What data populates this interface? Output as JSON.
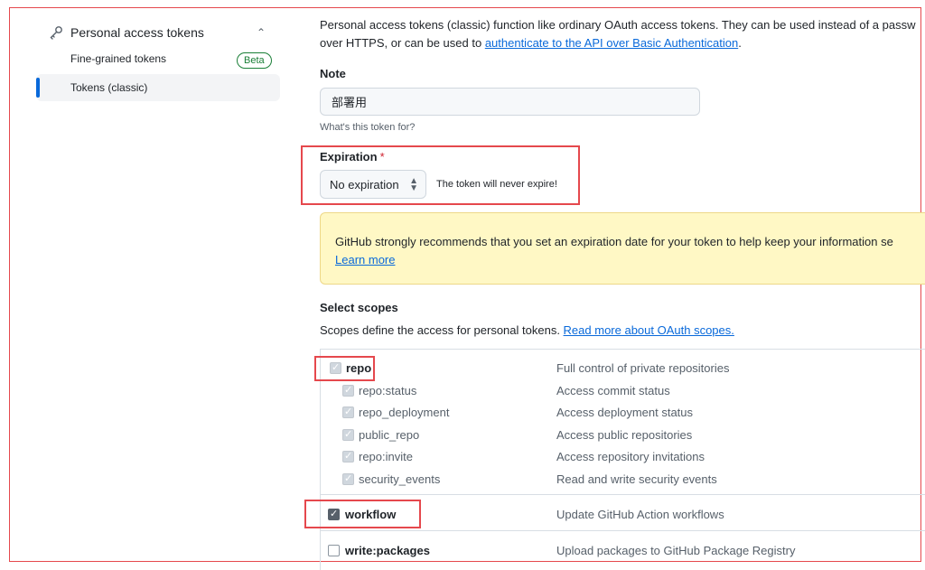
{
  "sidebar": {
    "section_label": "Personal access tokens",
    "items": [
      {
        "label": "Fine-grained tokens",
        "badge": "Beta"
      },
      {
        "label": "Tokens (classic)",
        "active": true
      }
    ]
  },
  "intro": {
    "line1": "Personal access tokens (classic) function like ordinary OAuth access tokens. They can be used instead of a passw",
    "line2_prefix": "over HTTPS, or can be used to ",
    "line2_link": "authenticate to the API over Basic Authentication",
    "line2_suffix": "."
  },
  "note": {
    "label": "Note",
    "value": "部署用",
    "hint": "What's this token for?"
  },
  "expiration": {
    "label": "Expiration",
    "required_mark": "*",
    "selected": "No expiration",
    "note": "The token will never expire!"
  },
  "warning": {
    "text": "GitHub strongly recommends that you set an expiration date for your token to help keep your information se",
    "link": "Learn more"
  },
  "scopes": {
    "title": "Select scopes",
    "desc_prefix": "Scopes define the access for personal tokens. ",
    "desc_link": "Read more about OAuth scopes.",
    "rows": [
      {
        "name": "repo",
        "desc": "Full control of private repositories",
        "state": "disabled-checked"
      },
      {
        "name": "repo:status",
        "desc": "Access commit status",
        "state": "disabled-checked"
      },
      {
        "name": "repo_deployment",
        "desc": "Access deployment status",
        "state": "disabled-checked"
      },
      {
        "name": "public_repo",
        "desc": "Access public repositories",
        "state": "disabled-checked"
      },
      {
        "name": "repo:invite",
        "desc": "Access repository invitations",
        "state": "disabled-checked"
      },
      {
        "name": "security_events",
        "desc": "Read and write security events",
        "state": "disabled-checked"
      },
      {
        "name": "workflow",
        "desc": "Update GitHub Action workflows",
        "state": "checked"
      },
      {
        "name": "write:packages",
        "desc": "Upload packages to GitHub Package Registry",
        "state": "unchecked"
      }
    ]
  },
  "colors": {
    "link": "#0969da",
    "annotation": "#e5484d",
    "warning_bg": "#fff8c5",
    "beta_green": "#1a7f37"
  },
  "icons": {
    "section": "key-icon",
    "collapse": "chevron-up-icon",
    "select": "select-updown-icon"
  }
}
